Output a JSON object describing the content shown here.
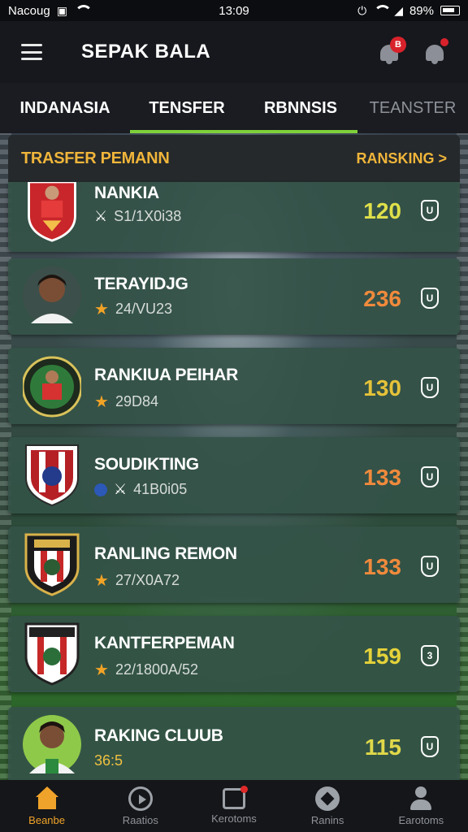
{
  "status_bar": {
    "carrier": "Nacoug",
    "time": "13:09",
    "battery_text": "89%"
  },
  "header": {
    "title": "SEPAK BALA",
    "notification_badge": "B"
  },
  "tabs": [
    {
      "label": "INDANASIA"
    },
    {
      "label": "TENSFER"
    },
    {
      "label": "RBNNSIS"
    },
    {
      "label": "TEANSTER"
    }
  ],
  "section": {
    "title": "TRASFER PEMANN",
    "link": "RANSKING >"
  },
  "rows": [
    {
      "name": "NANKIA",
      "sub_icon": "fixture-icon",
      "sub": "S1/1X0i38",
      "score": "120",
      "score_color": "#dfe04a",
      "action": "U"
    },
    {
      "name": "TERAYIDJG",
      "sub_icon": "star-icon",
      "sub": "24/VU23",
      "score": "236",
      "score_color": "#f08a3c",
      "action": "U"
    },
    {
      "name": "RANKIUA PEIHAR",
      "sub_icon": "star-icon",
      "sub": "29D84",
      "score": "130",
      "score_color": "#e5c23a",
      "action": "U"
    },
    {
      "name": "SOUDIKTING",
      "sub_icon": "fixture-icon",
      "sub": "41B0i05",
      "score": "133",
      "score_color": "#f08a3c",
      "action": "U"
    },
    {
      "name": "RANLING REMON",
      "sub_icon": "star-icon",
      "sub": "27/X0A72",
      "score": "133",
      "score_color": "#f08a3c",
      "action": "U"
    },
    {
      "name": "KANTFERPEMAN",
      "sub_icon": "star-icon",
      "sub": "22/1800A/52",
      "score": "159",
      "score_color": "#e5d23a",
      "action": "3"
    },
    {
      "name": "RAKING CLUUB",
      "sub_icon": "none",
      "sub": "36:5",
      "score": "115",
      "score_color": "#e0d84a",
      "action": "U"
    }
  ],
  "bottom_nav": [
    {
      "label": "Beanbe",
      "icon": "home-icon"
    },
    {
      "label": "Raatios",
      "icon": "play-icon"
    },
    {
      "label": "Kerotoms",
      "icon": "edit-icon"
    },
    {
      "label": "Ranins",
      "icon": "ball-icon"
    },
    {
      "label": "Earotoms",
      "icon": "user-icon"
    }
  ],
  "colors": {
    "accent_green": "#7fd03a",
    "accent_orange": "#f0b53a"
  }
}
